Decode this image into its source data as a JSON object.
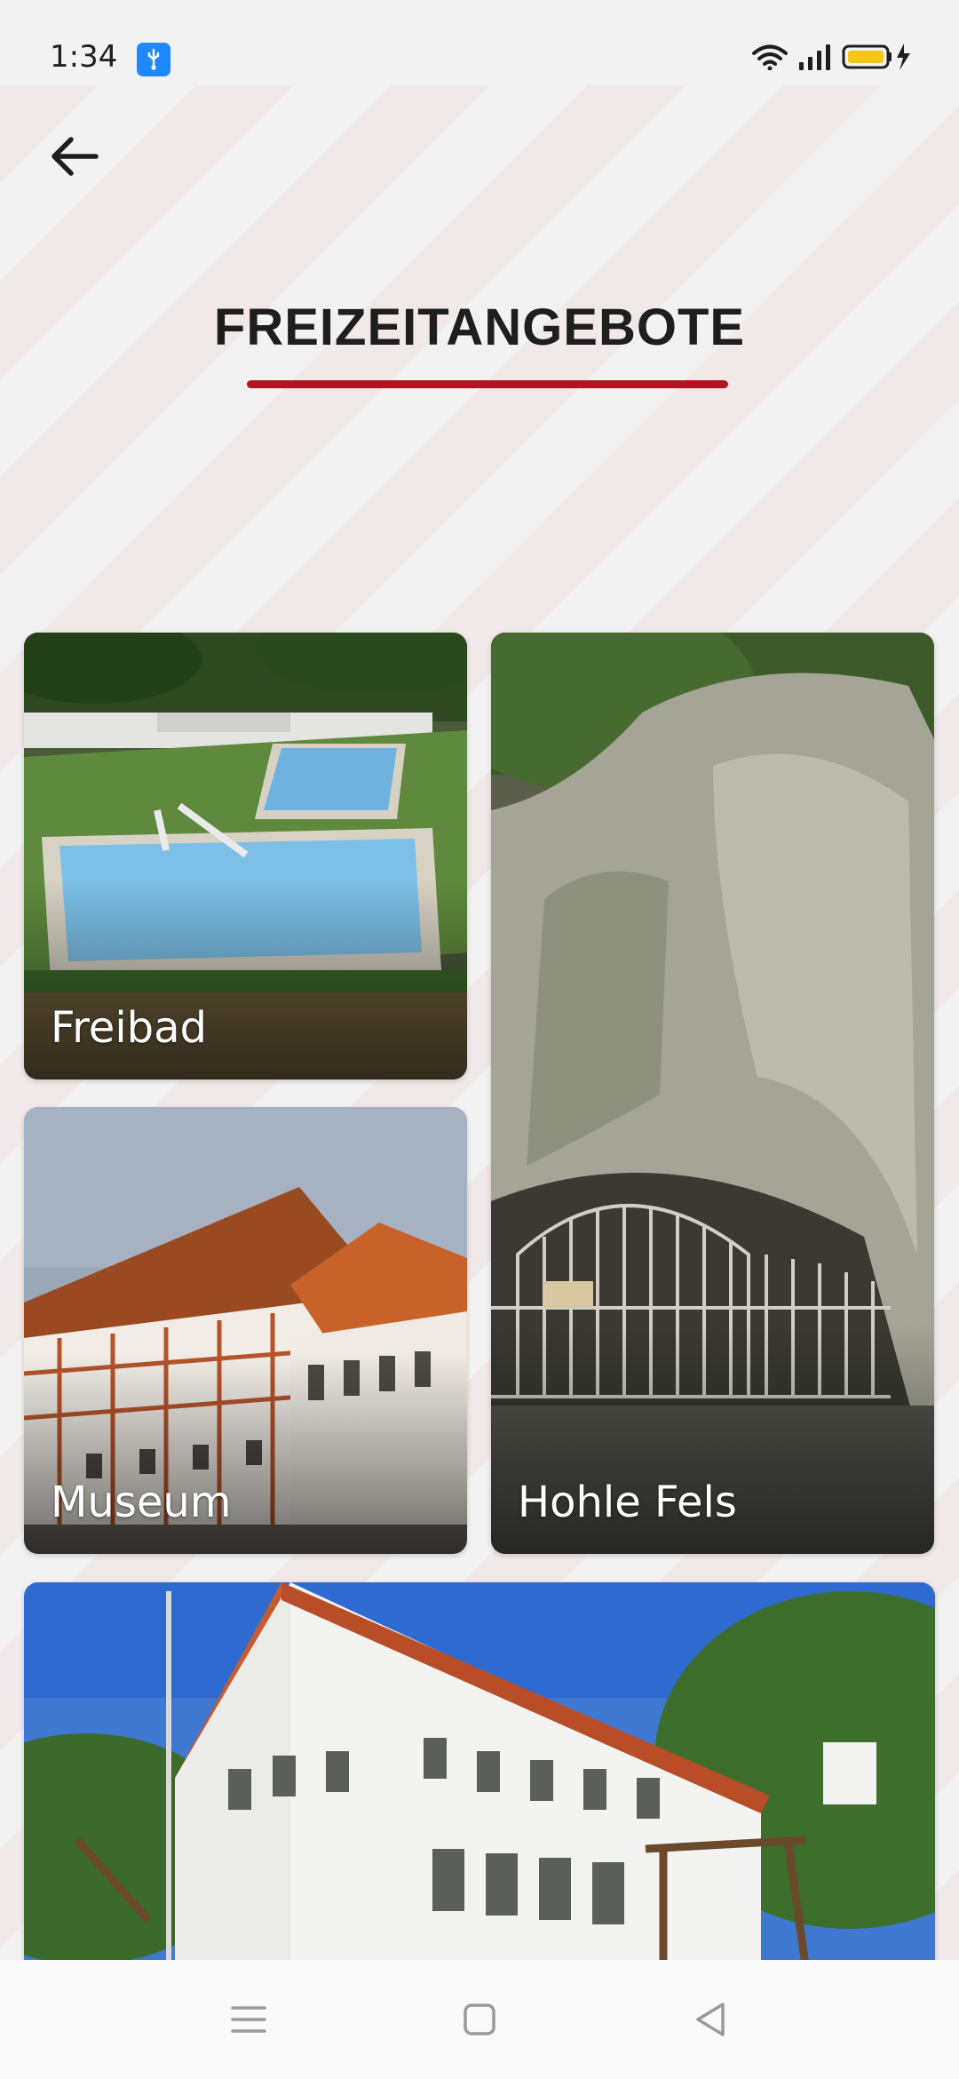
{
  "status_bar": {
    "time": "1:34",
    "icons": [
      "usb-debug-icon",
      "wifi-icon",
      "signal-icon",
      "battery-charging-icon"
    ],
    "battery_color": "#f5c518",
    "usb_badge_color": "#1e88ff"
  },
  "header": {
    "back_icon": "arrow-left-icon",
    "title": "FREIZEITANGEBOTE",
    "accent_color": "#b3121f"
  },
  "cards": [
    {
      "label": "Freibad"
    },
    {
      "label": "Hohle Fels"
    },
    {
      "label": "Museum"
    },
    {
      "label": ""
    }
  ],
  "nav_bar": {
    "icons": [
      "menu-icon",
      "home-square-icon",
      "back-triangle-icon"
    ]
  }
}
